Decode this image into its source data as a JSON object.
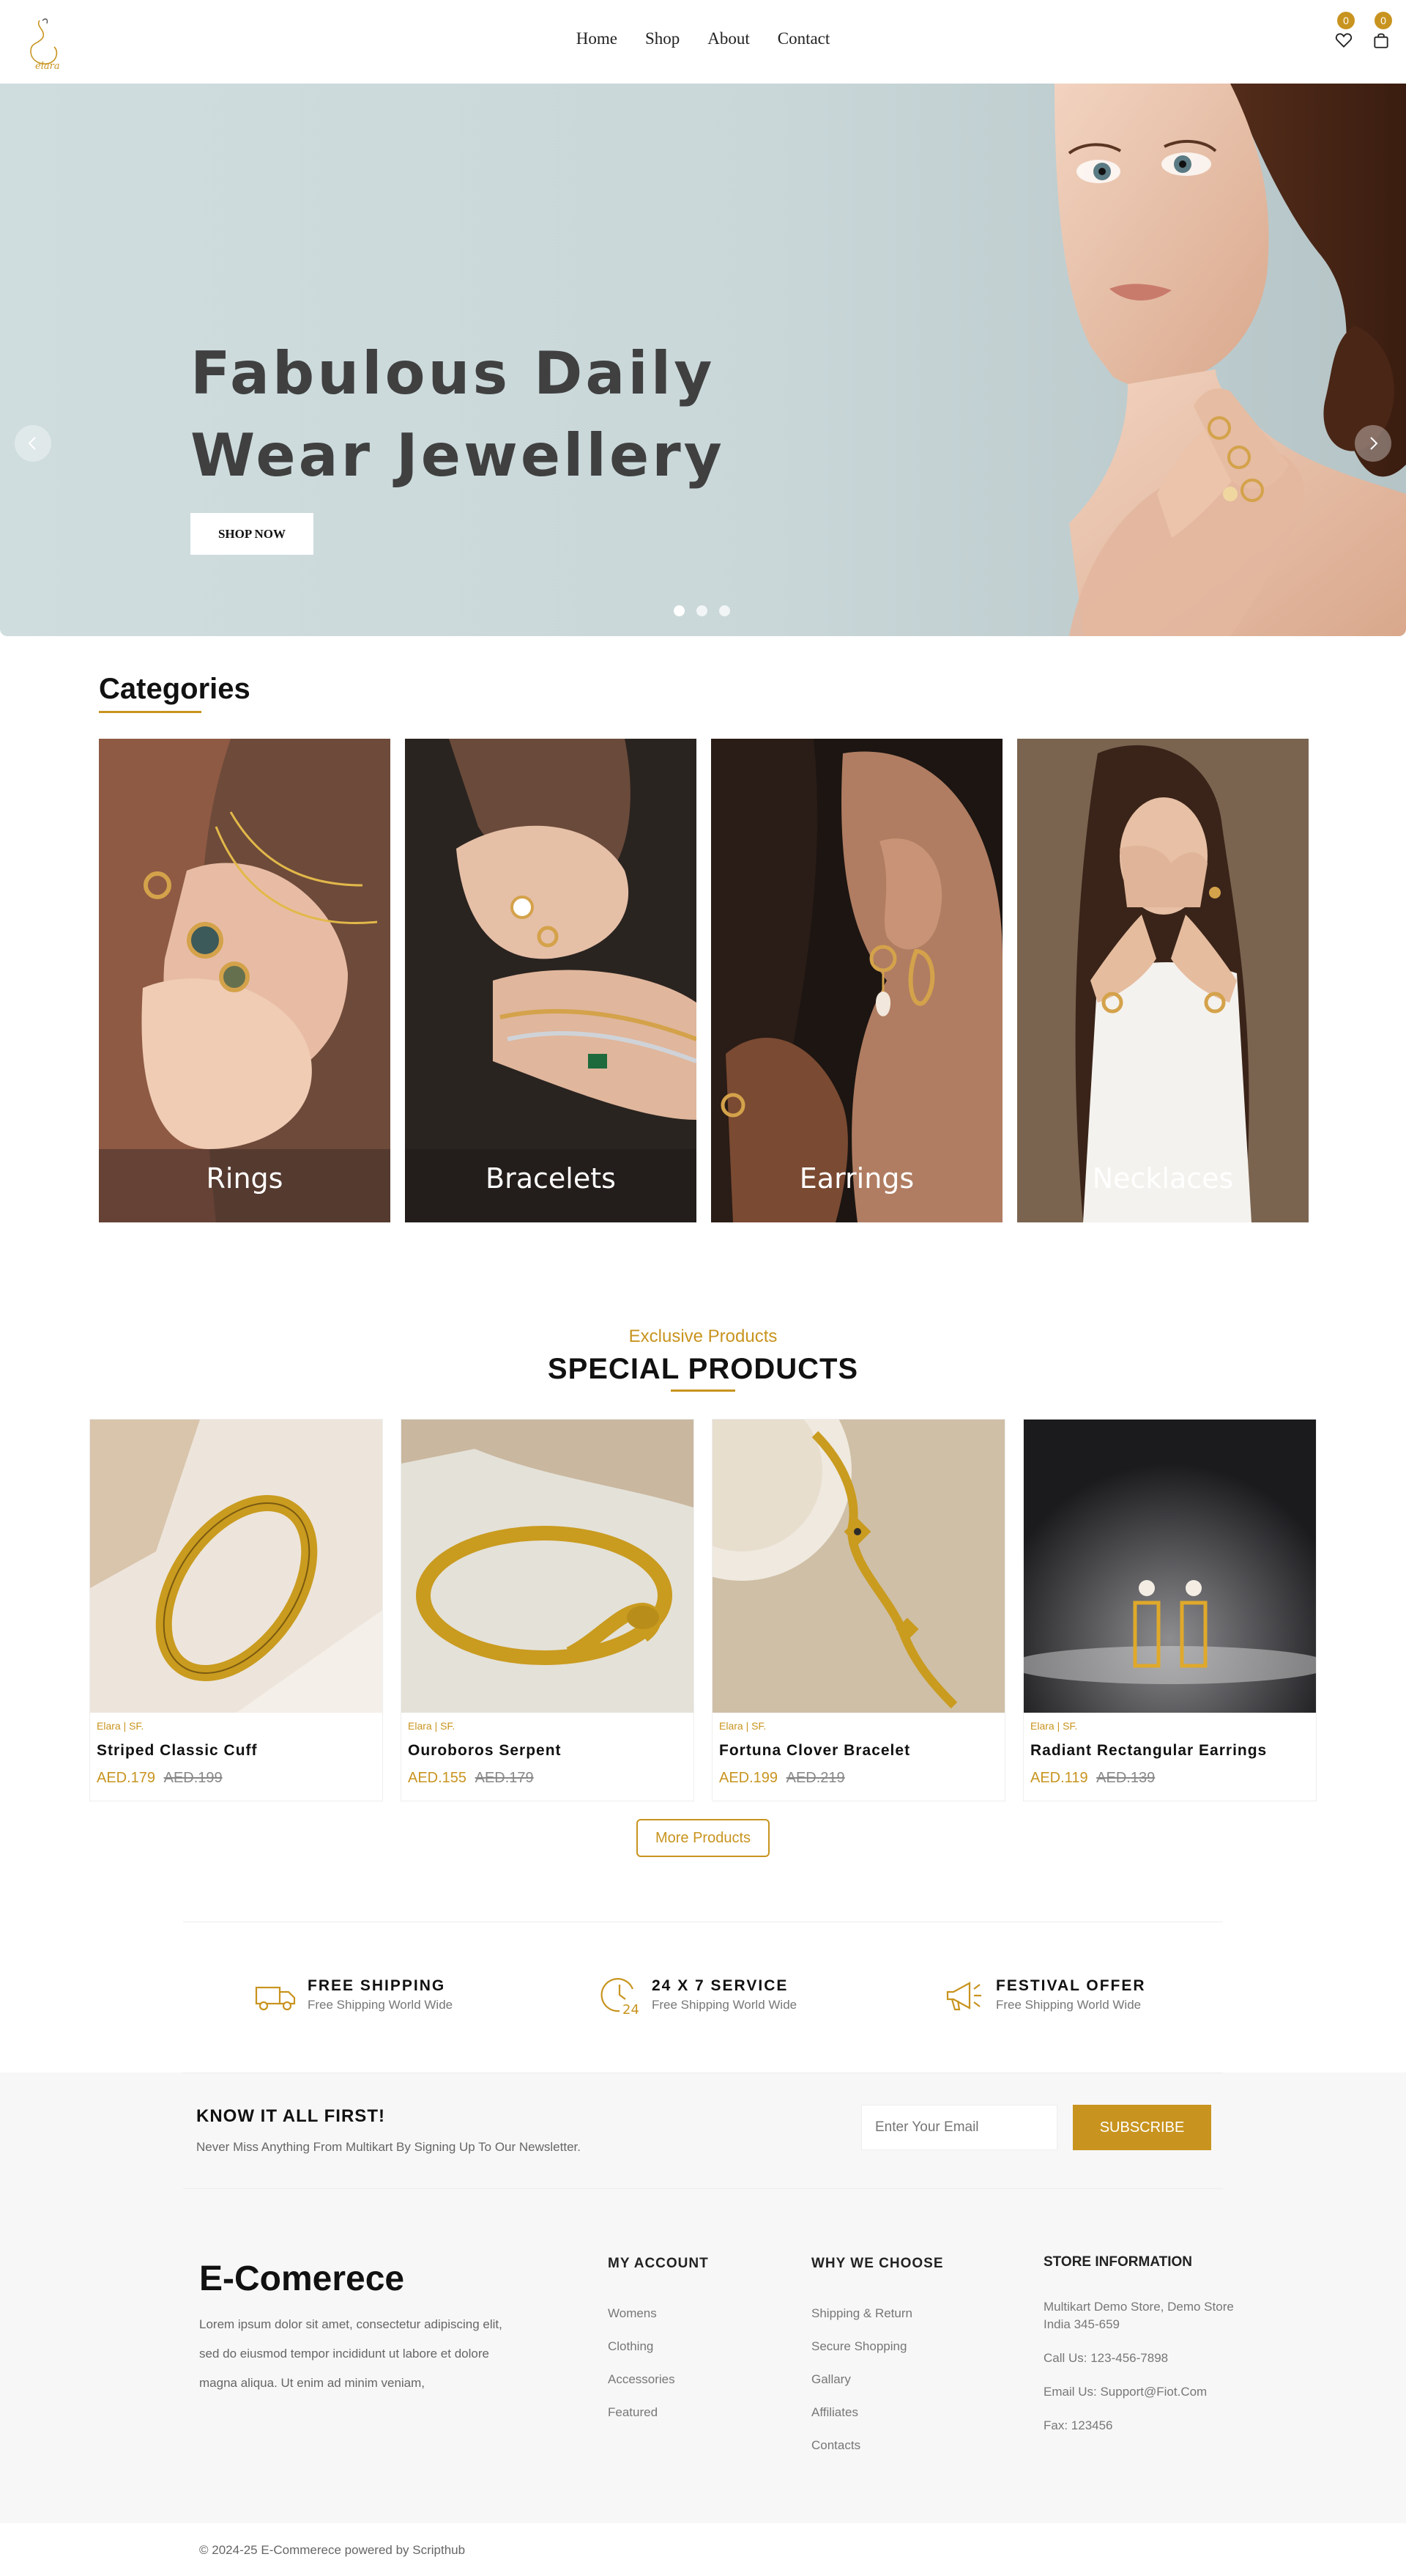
{
  "header": {
    "logo_text": "elara",
    "nav": [
      "Home",
      "Shop",
      "About",
      "Contact"
    ],
    "wishlist_count": "0",
    "cart_count": "0"
  },
  "hero": {
    "title_line1": "Fabulous Daily",
    "title_line2": "Wear Jewellery",
    "cta": "SHOP NOW",
    "slides": 3,
    "active_slide": 1
  },
  "categories": {
    "title": "Categories",
    "items": [
      {
        "label": "Rings"
      },
      {
        "label": "Bracelets"
      },
      {
        "label": "Earrings"
      },
      {
        "label": "Necklaces"
      }
    ]
  },
  "special": {
    "kicker": "Exclusive Products",
    "title": "SPECIAL PRODUCTS",
    "products": [
      {
        "brand": "Elara | SF.",
        "name": "Striped Classic Cuff",
        "price": "AED.179",
        "old_price": "AED.199"
      },
      {
        "brand": "Elara | SF.",
        "name": "Ouroboros Serpent",
        "price": "AED.155",
        "old_price": "AED.179"
      },
      {
        "brand": "Elara | SF.",
        "name": "Fortuna Clover Bracelet",
        "price": "AED.199",
        "old_price": "AED.219"
      },
      {
        "brand": "Elara | SF.",
        "name": "Radiant Rectangular Earrings",
        "price": "AED.119",
        "old_price": "AED.139"
      }
    ],
    "more_button": "More Products"
  },
  "services": [
    {
      "icon": "truck-icon",
      "title": "FREE SHIPPING",
      "subtitle": "Free Shipping World Wide"
    },
    {
      "icon": "clock-24-icon",
      "title": "24 X 7 SERVICE",
      "subtitle": "Free Shipping World Wide"
    },
    {
      "icon": "megaphone-icon",
      "title": "FESTIVAL OFFER",
      "subtitle": "Free Shipping World Wide"
    }
  ],
  "newsletter": {
    "title": "KNOW IT ALL FIRST!",
    "subtitle": "Never Miss Anything From Multikart By Signing Up To Our Newsletter.",
    "placeholder": "Enter Your Email",
    "button": "SUBSCRIBE"
  },
  "footer": {
    "brand": "E-Comerece",
    "about": "Lorem ipsum dolor sit amet, consectetur adipiscing elit, sed do eiusmod tempor incididunt ut labore et dolore magna aliqua. Ut enim ad minim veniam,",
    "account": {
      "title": "MY ACCOUNT",
      "links": [
        "Womens",
        "Clothing",
        "Accessories",
        "Featured"
      ]
    },
    "why": {
      "title": "WHY WE CHOOSE",
      "links": [
        "Shipping & Return",
        "Secure Shopping",
        "Gallary",
        "Affiliates",
        "Contacts"
      ]
    },
    "store": {
      "title": "STORE INFORMATION",
      "address": "Multikart Demo Store, Demo Store India 345-659",
      "phone": "Call Us: 123-456-7898",
      "email": "Email Us: Support@Fiot.Com",
      "fax": "Fax: 123456"
    },
    "copyright": "© 2024-25 E-Commerece powered by Scripthub"
  },
  "colors": {
    "accent": "#c8941f",
    "hero_bg": "#cddbdd",
    "footer_bg": "#f7f7f7"
  }
}
